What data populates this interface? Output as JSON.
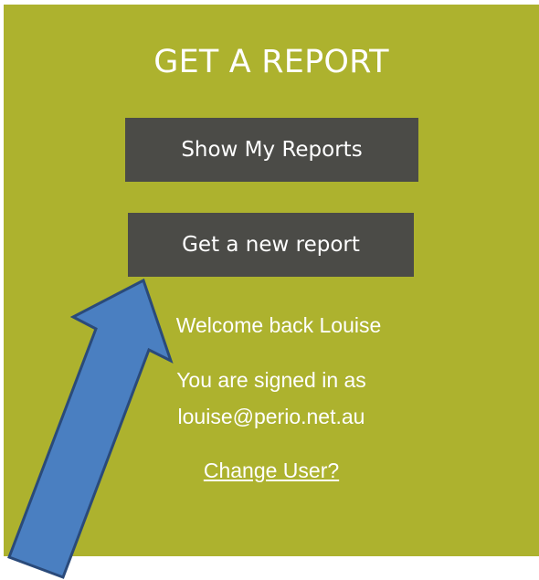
{
  "report_panel": {
    "title": "GET A REPORT",
    "show_reports_label": "Show My Reports",
    "new_report_label": "Get a new report",
    "welcome_text": "Welcome back Louise",
    "signed_in_text": "You are signed in as",
    "email": "louise@perio.net.au",
    "change_user_label": "Change User?"
  },
  "colors": {
    "panel_background": "#adb22e",
    "button_background": "#4b4b47",
    "text": "#ffffff",
    "arrow_fill": "#4a7fc1",
    "arrow_stroke": "#2a4a7a"
  },
  "annotation": {
    "arrow_icon": "blue-pointer-arrow-icon"
  }
}
